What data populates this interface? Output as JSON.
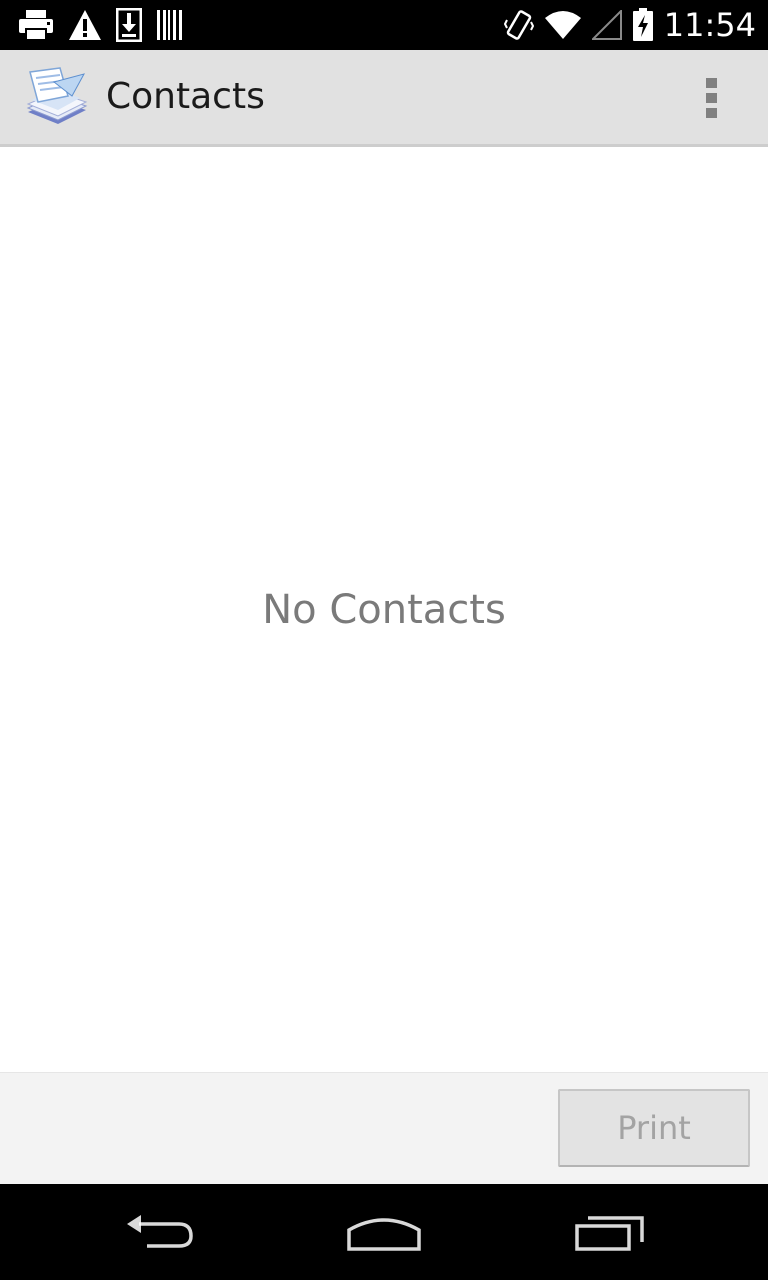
{
  "status_bar": {
    "time": "11:54",
    "left_icons": [
      "printer-icon",
      "warning-icon",
      "download-icon",
      "barcode-icon"
    ],
    "right_icons": [
      "vibrate-icon",
      "wifi-icon",
      "signal-icon",
      "battery-charging-icon"
    ]
  },
  "action_bar": {
    "title": "Contacts",
    "app_icon": "printer-paper-app-icon",
    "overflow_icon": "overflow-menu-icon"
  },
  "content": {
    "empty_message": "No Contacts"
  },
  "bottom_panel": {
    "print_label": "Print",
    "print_enabled": false
  },
  "nav_bar": {
    "buttons": [
      "back-icon",
      "home-icon",
      "recent-apps-icon"
    ]
  },
  "colors": {
    "status_bar_bg": "#000000",
    "action_bar_bg": "#e1e1e1",
    "content_bg": "#ffffff",
    "empty_text": "#7a7a7a",
    "bottom_panel_bg": "#f3f3f3",
    "disabled_button_text": "#a3a3a3"
  }
}
